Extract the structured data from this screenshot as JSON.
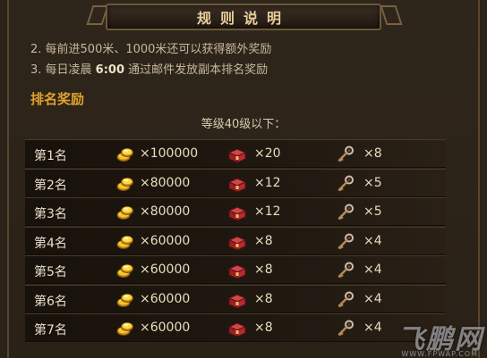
{
  "title": "规则说明",
  "rules": [
    "2. 每前进500米、1000米还可以获得额外奖励",
    {
      "prefix": "3. 每日凌晨 ",
      "highlight": "6:00",
      "suffix": " 通过邮件发放副本排名奖励"
    }
  ],
  "section_title": "排名奖励",
  "level_label": "等级40级以下：",
  "reward_rows": [
    {
      "rank": "第1名",
      "gold": "×100000",
      "chest": "×20",
      "key": "×8"
    },
    {
      "rank": "第2名",
      "gold": "×80000",
      "chest": "×12",
      "key": "×5"
    },
    {
      "rank": "第3名",
      "gold": "×80000",
      "chest": "×12",
      "key": "×5"
    },
    {
      "rank": "第4名",
      "gold": "×60000",
      "chest": "×8",
      "key": "×4"
    },
    {
      "rank": "第5名",
      "gold": "×60000",
      "chest": "×8",
      "key": "×4"
    },
    {
      "rank": "第6名",
      "gold": "×60000",
      "chest": "×8",
      "key": "×4"
    },
    {
      "rank": "第7名",
      "gold": "×60000",
      "chest": "×8",
      "key": "×4"
    }
  ],
  "icons": {
    "gold": "gold-coins-icon",
    "chest": "red-chest-icon",
    "key": "key-icon"
  },
  "watermark": {
    "text": "飞鹏网",
    "url": "WWW.FPWAP.COM"
  }
}
